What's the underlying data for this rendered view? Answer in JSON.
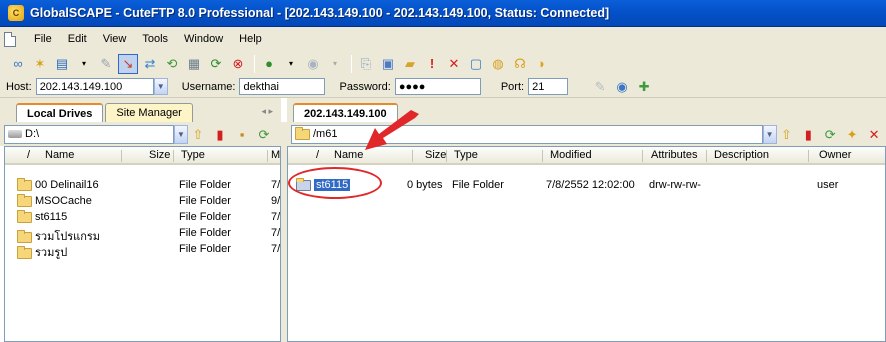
{
  "window": {
    "title": "GlobalSCAPE - CuteFTP 8.0 Professional - [202.143.149.100 - 202.143.149.100, Status: Connected]"
  },
  "menu": [
    "File",
    "Edit",
    "View",
    "Tools",
    "Window",
    "Help"
  ],
  "connection": {
    "host_label": "Host:",
    "host_value": "202.143.149.100",
    "username_label": "Username:",
    "username_value": "dekthai",
    "password_label": "Password:",
    "password_value": "●●●●",
    "port_label": "Port:",
    "port_value": "21"
  },
  "tabs": {
    "local": "Local Drives",
    "site": "Site Manager",
    "remote": "202.143.149.100"
  },
  "local_pane": {
    "path": "D:\\",
    "columns": [
      "/",
      "Name",
      "Size",
      "Type",
      "M"
    ],
    "rows": [
      {
        "name": "00 Delinail16",
        "size": "",
        "type": "File Folder",
        "mod": "7/"
      },
      {
        "name": "MSOCache",
        "size": "",
        "type": "File Folder",
        "mod": "9/"
      },
      {
        "name": "st6115",
        "size": "",
        "type": "File Folder",
        "mod": "7/"
      },
      {
        "name": "รวมโปรแกรม",
        "size": "",
        "type": "File Folder",
        "mod": "7/"
      },
      {
        "name": "รวมรูป",
        "size": "",
        "type": "File Folder",
        "mod": "7/"
      }
    ]
  },
  "remote_pane": {
    "path": "/m61",
    "columns": [
      "/",
      "Name",
      "Size",
      "Type",
      "Modified",
      "Attributes",
      "Description",
      "Owner"
    ],
    "rows": [
      {
        "name": "st6115",
        "size": "0 bytes",
        "type": "File Folder",
        "modified": "7/8/2552 12:02:00",
        "attributes": "drw-rw-rw-",
        "description": "",
        "owner": "user"
      }
    ]
  },
  "colors": {
    "title_bar": "#0450c8",
    "annotation": "#e0282a",
    "selection": "#316ac5",
    "chrome": "#ece9d8"
  }
}
